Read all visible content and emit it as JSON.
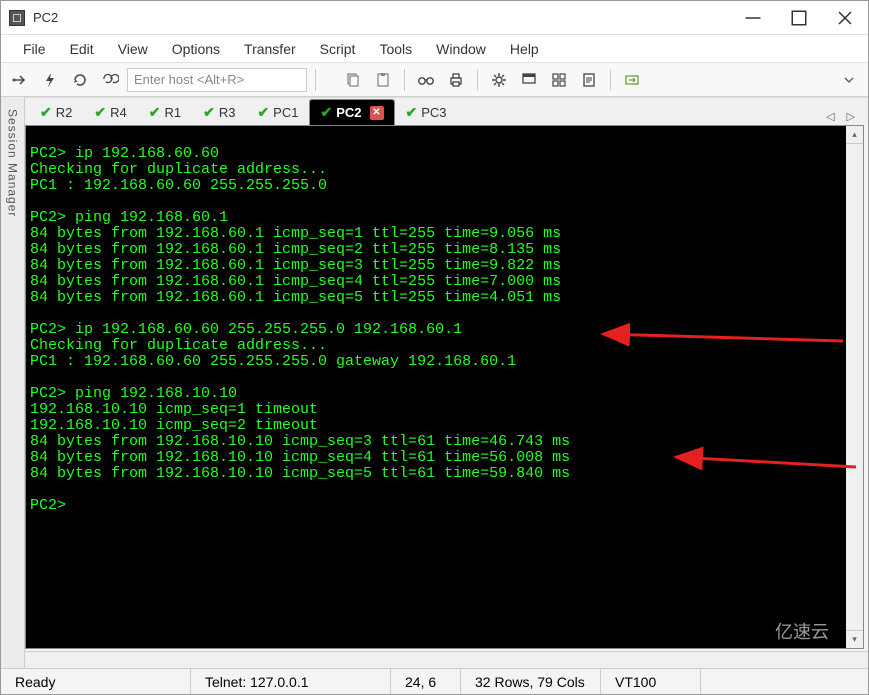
{
  "window": {
    "title": "PC2"
  },
  "menubar": {
    "items": [
      "File",
      "Edit",
      "View",
      "Options",
      "Transfer",
      "Script",
      "Tools",
      "Window",
      "Help"
    ]
  },
  "toolbar": {
    "host_placeholder": "Enter host <Alt+R>"
  },
  "sidebar": {
    "label": "Session Manager"
  },
  "tabs": [
    {
      "label": "R2",
      "checked": true,
      "active": false,
      "closable": false
    },
    {
      "label": "R4",
      "checked": true,
      "active": false,
      "closable": false
    },
    {
      "label": "R1",
      "checked": true,
      "active": false,
      "closable": false
    },
    {
      "label": "R3",
      "checked": true,
      "active": false,
      "closable": false
    },
    {
      "label": "PC1",
      "checked": true,
      "active": false,
      "closable": false
    },
    {
      "label": "PC2",
      "checked": true,
      "active": true,
      "closable": true
    },
    {
      "label": "PC3",
      "checked": true,
      "active": false,
      "closable": false
    }
  ],
  "terminal": {
    "lines": [
      "",
      "PC2> ip 192.168.60.60",
      "Checking for duplicate address...",
      "PC1 : 192.168.60.60 255.255.255.0",
      "",
      "PC2> ping 192.168.60.1",
      "84 bytes from 192.168.60.1 icmp_seq=1 ttl=255 time=9.056 ms",
      "84 bytes from 192.168.60.1 icmp_seq=2 ttl=255 time=8.135 ms",
      "84 bytes from 192.168.60.1 icmp_seq=3 ttl=255 time=9.822 ms",
      "84 bytes from 192.168.60.1 icmp_seq=4 ttl=255 time=7.000 ms",
      "84 bytes from 192.168.60.1 icmp_seq=5 ttl=255 time=4.051 ms",
      "",
      "PC2> ip 192.168.60.60 255.255.255.0 192.168.60.1",
      "Checking for duplicate address...",
      "PC1 : 192.168.60.60 255.255.255.0 gateway 192.168.60.1",
      "",
      "PC2> ping 192.168.10.10",
      "192.168.10.10 icmp_seq=1 timeout",
      "192.168.10.10 icmp_seq=2 timeout",
      "84 bytes from 192.168.10.10 icmp_seq=3 ttl=61 time=46.743 ms",
      "84 bytes from 192.168.10.10 icmp_seq=4 ttl=61 time=56.008 ms",
      "84 bytes from 192.168.10.10 icmp_seq=5 ttl=61 time=59.840 ms",
      "",
      "PC2>"
    ]
  },
  "statusbar": {
    "ready": "Ready",
    "protocol": "Telnet: 127.0.0.1",
    "cursor": "24,   6",
    "size": "32 Rows, 79 Cols",
    "term": "VT100"
  },
  "brand": "亿速云"
}
